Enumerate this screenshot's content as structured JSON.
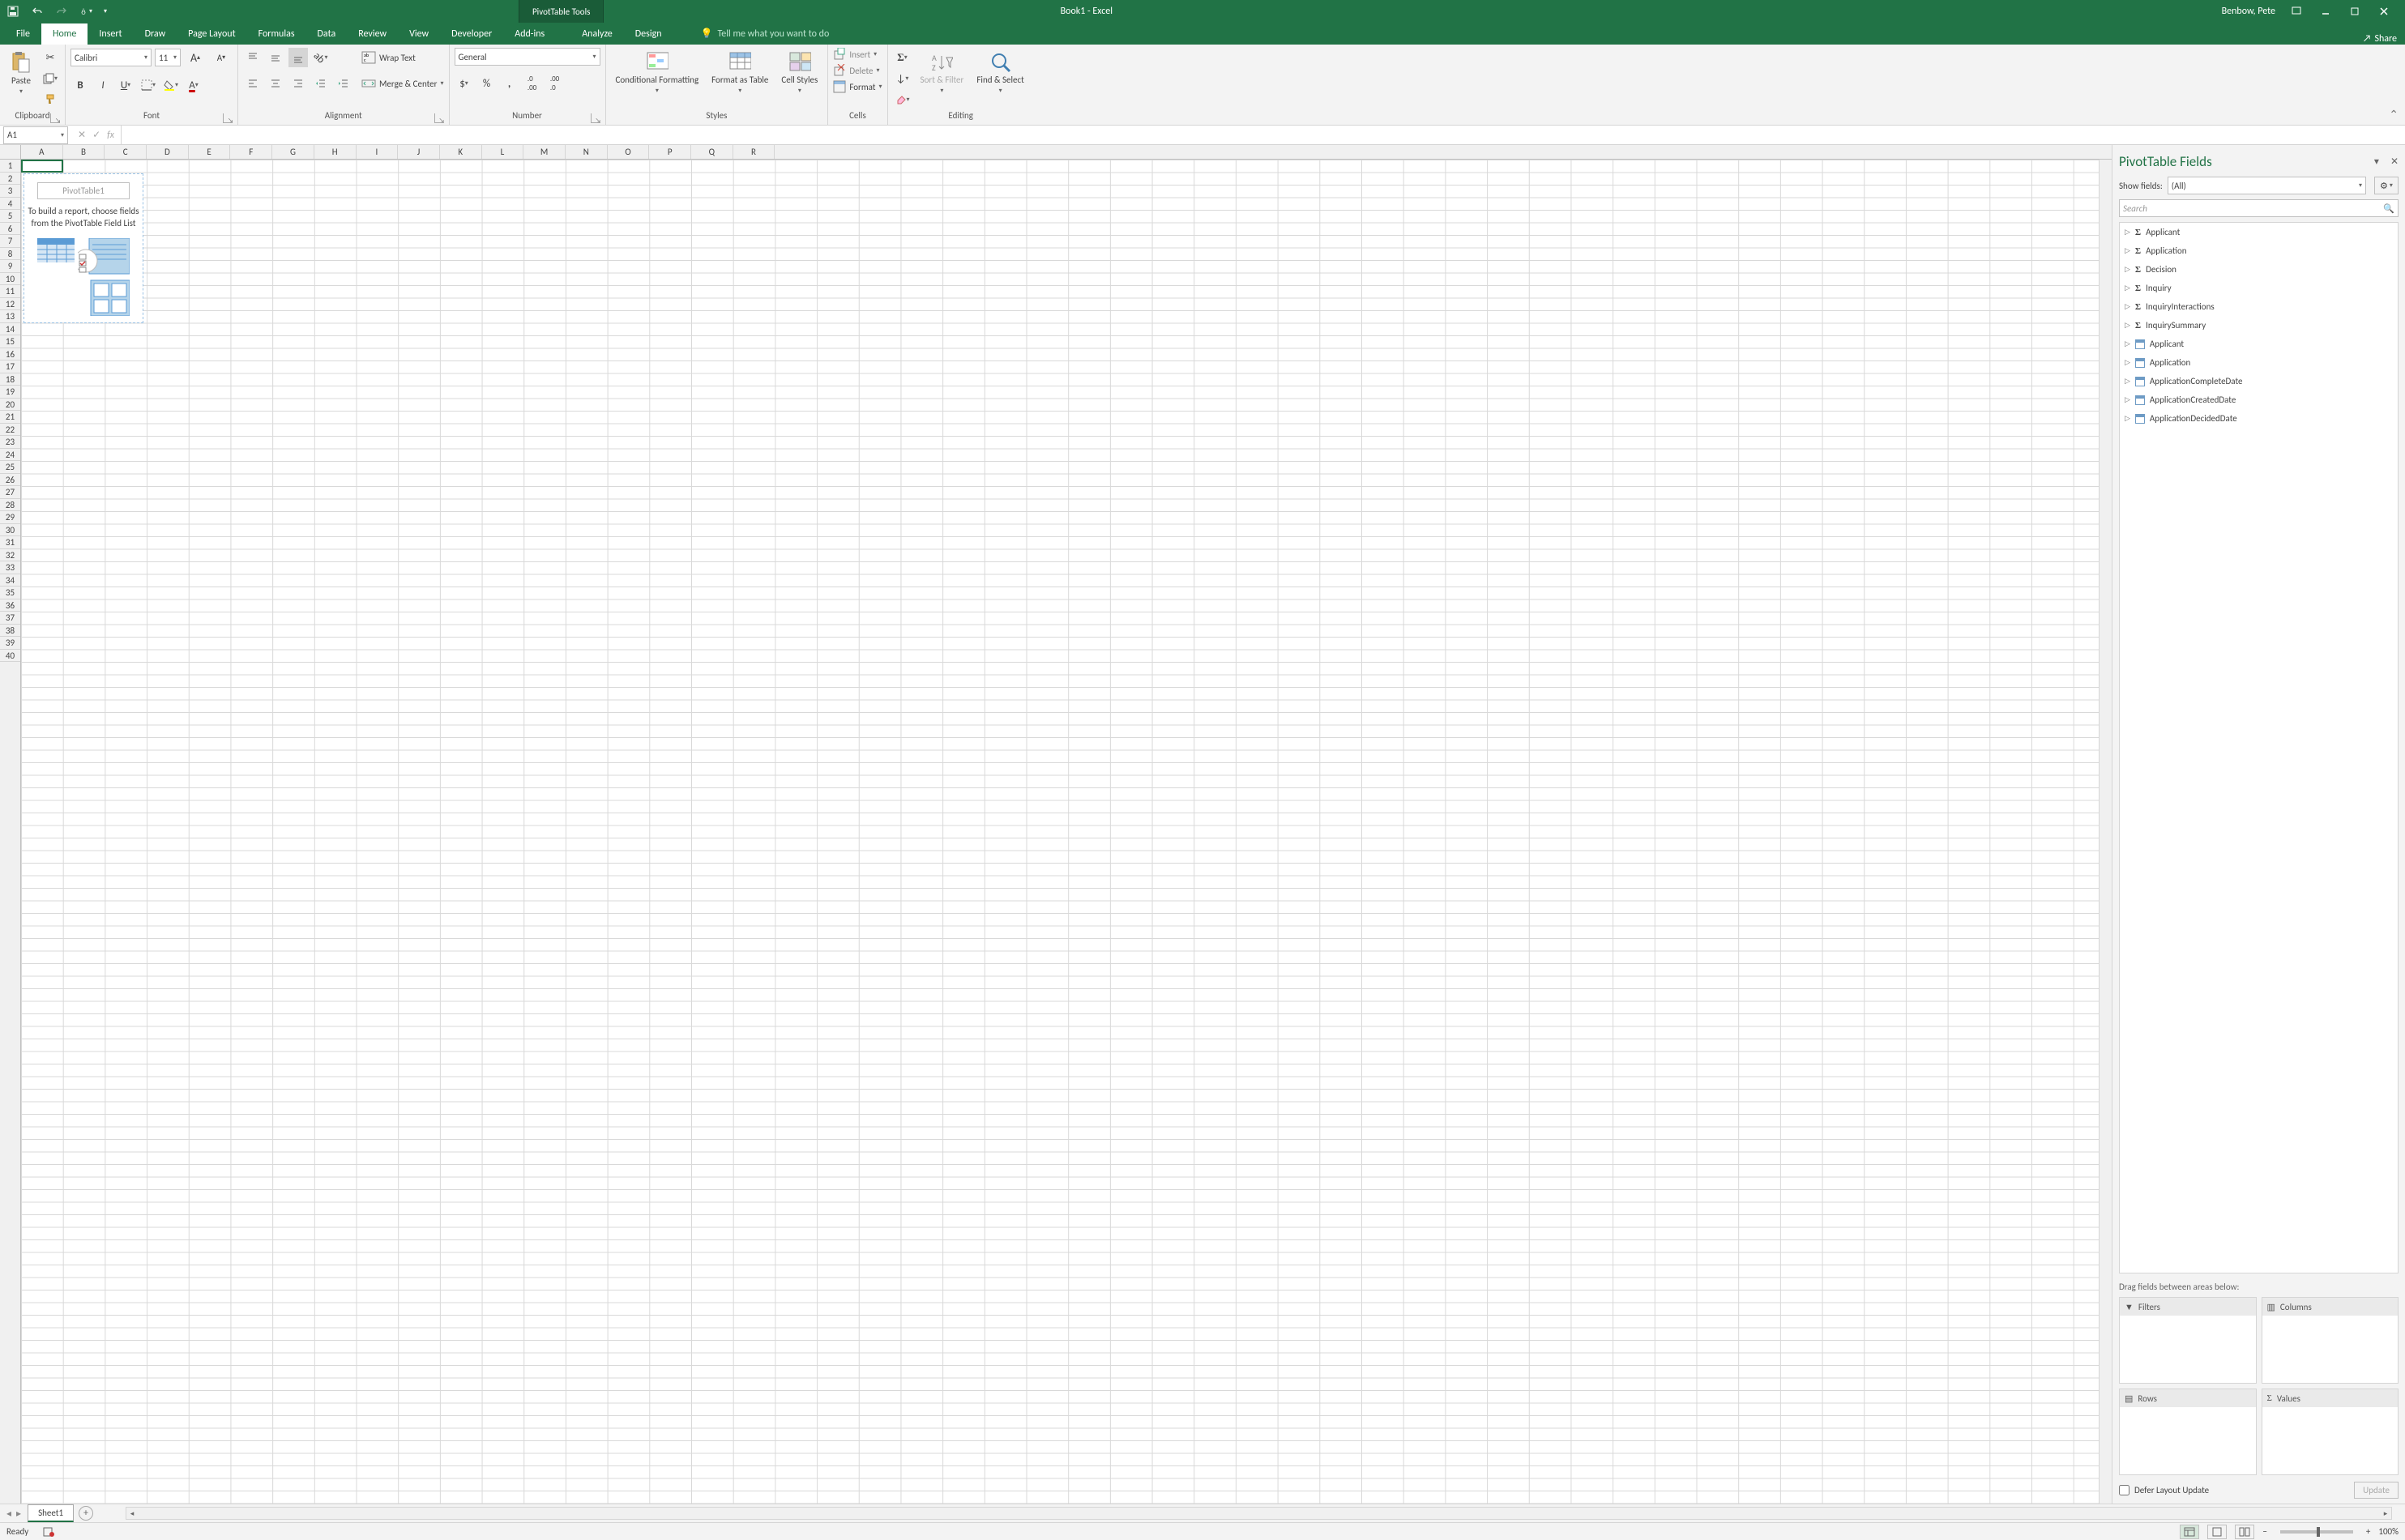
{
  "titlebar": {
    "doc_title": "Book1 - Excel",
    "context_tools": "PivotTable Tools",
    "user": "Benbow, Pete"
  },
  "tabs": {
    "items": [
      "File",
      "Home",
      "Insert",
      "Draw",
      "Page Layout",
      "Formulas",
      "Data",
      "Review",
      "View",
      "Developer",
      "Add-ins",
      "Analyze",
      "Design"
    ],
    "active": "Home",
    "tellme_placeholder": "Tell me what you want to do",
    "share": "Share"
  },
  "ribbon": {
    "clipboard": {
      "paste": "Paste",
      "label": "Clipboard"
    },
    "font": {
      "name": "Calibri",
      "size": "11",
      "label": "Font"
    },
    "alignment": {
      "wrap": "Wrap Text",
      "merge": "Merge & Center",
      "label": "Alignment"
    },
    "number": {
      "format": "General",
      "label": "Number"
    },
    "styles": {
      "cond": "Conditional Formatting",
      "table": "Format as Table",
      "cell": "Cell Styles",
      "label": "Styles"
    },
    "cells": {
      "insert": "Insert",
      "delete": "Delete",
      "format": "Format",
      "label": "Cells"
    },
    "editing": {
      "sort": "Sort & Filter",
      "find": "Find & Select",
      "label": "Editing"
    }
  },
  "name_box": "A1",
  "pivot_placeholder": {
    "title": "PivotTable1",
    "hint": "To build a report, choose fields from the PivotTable Field List"
  },
  "sheet": {
    "name": "Sheet1",
    "columns": [
      "A",
      "B",
      "C",
      "D",
      "E",
      "F",
      "G",
      "H",
      "I",
      "J",
      "K",
      "L",
      "M",
      "N",
      "O",
      "P",
      "Q",
      "R"
    ]
  },
  "task_pane": {
    "title": "PivotTable Fields",
    "show_fields_label": "Show fields:",
    "show_fields_value": "(All)",
    "search_placeholder": "Search",
    "fields_measure": [
      "Applicant",
      "Application",
      "Decision",
      "Inquiry",
      "InquiryInteractions",
      "InquirySummary"
    ],
    "fields_table": [
      "Applicant",
      "Application",
      "ApplicationCompleteDate",
      "ApplicationCreatedDate",
      "ApplicationDecidedDate"
    ],
    "drag_hint": "Drag fields between areas below:",
    "areas": {
      "filters": "Filters",
      "columns": "Columns",
      "rows": "Rows",
      "values": "Values"
    },
    "defer": "Defer Layout Update",
    "update": "Update"
  },
  "status": {
    "ready": "Ready",
    "zoom": "100%"
  }
}
